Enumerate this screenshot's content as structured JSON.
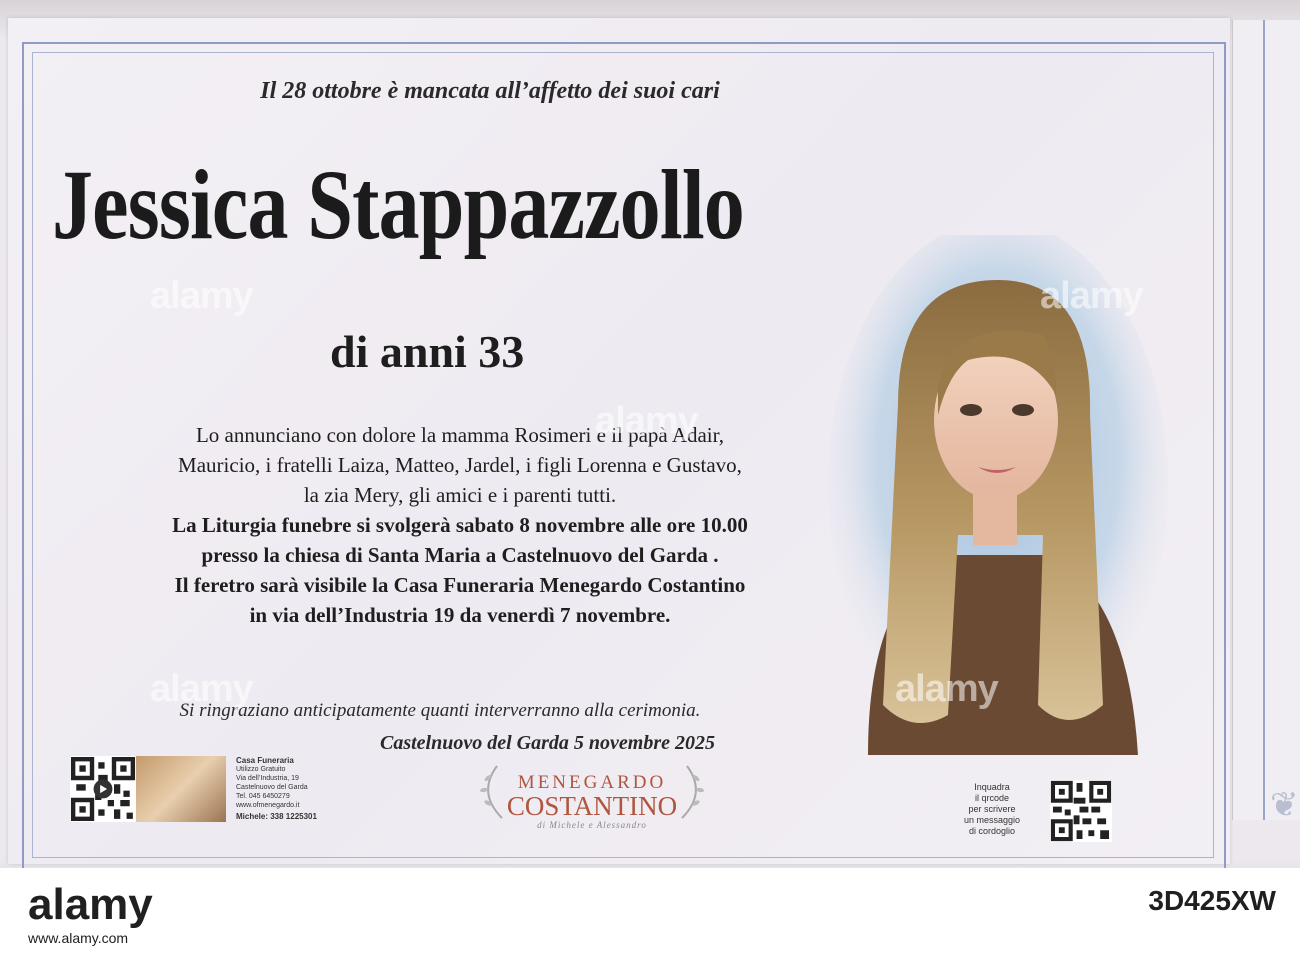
{
  "poster": {
    "intro": "Il 28 ottobre è mancata all’affetto dei suoi cari",
    "name": "Jessica Stappazzollo",
    "age": "di anni 33",
    "announcement": [
      "Lo annunciano con  dolore la mamma Rosimeri e il papà Adair,",
      "Mauricio, i fratelli Laiza, Matteo, Jardel, i figli Lorenna e Gustavo,",
      "la zia Mery, gli amici e i parenti tutti."
    ],
    "funeral": [
      "La Liturgia funebre si svolgerà sabato 8 novembre alle ore 10.00",
      "presso la chiesa di Santa Maria a Castelnuovo del Garda .",
      "Il feretro sarà visibile la Casa Funeraria Menegardo Costantino",
      "in via dell’Industria 19 da venerdì 7 novembre."
    ],
    "thanks": "Si ringraziano anticipatamente quanti interverranno alla cerimonia.",
    "place_date": "Castelnuovo del Garda 5 novembre 2025"
  },
  "footer": {
    "info_title": "Casa Funeraria",
    "info_lines": [
      "Utilizzo Gratuito",
      "Via dell’Industria, 19",
      "Castelnuovo del Garda",
      "Tel. 045 6450279",
      "www.ofmenegardo.it"
    ],
    "info_phone": "Michele: 338 1225301",
    "logo_top": "MENEGARDO",
    "logo_main": "COSTANTINO",
    "logo_sub": "di Michele e Alessandro",
    "qr_note": [
      "Inquadra",
      "il qrcode",
      "per scrivere",
      "un messaggio",
      "di cordoglio"
    ]
  },
  "watermark": {
    "text": "alamy",
    "bottom_logo": "alamy",
    "image_id": "3D425XW",
    "site": "www.alamy.com"
  }
}
